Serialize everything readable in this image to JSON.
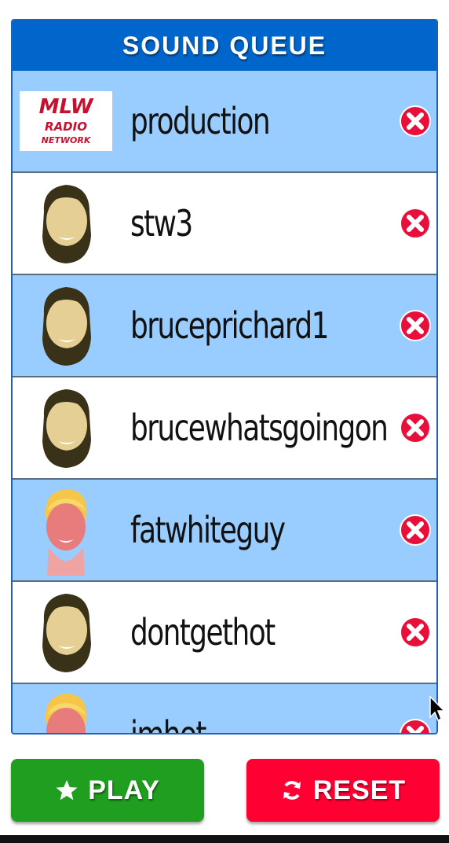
{
  "header": {
    "title": "SOUND QUEUE"
  },
  "queue": {
    "items": [
      {
        "label": "production",
        "avatar": "mlw-radio-network-logo",
        "bg": "blue"
      },
      {
        "label": "stw3",
        "avatar": "bearded-man-face",
        "bg": "white"
      },
      {
        "label": "bruceprichard1",
        "avatar": "bearded-man-face",
        "bg": "blue"
      },
      {
        "label": "brucewhatsgoingon",
        "avatar": "bearded-man-face",
        "bg": "white"
      },
      {
        "label": "fatwhiteguy",
        "avatar": "blonde-man-face",
        "bg": "blue"
      },
      {
        "label": "dontgethot",
        "avatar": "bearded-man-face",
        "bg": "white"
      },
      {
        "label": "imhot",
        "avatar": "blonde-man-face",
        "bg": "blue"
      }
    ],
    "logo_text": {
      "top": "MLW",
      "mid": "RADIO",
      "bottom": "NETWORK"
    }
  },
  "controls": {
    "play_label": "PLAY",
    "reset_label": "RESET"
  },
  "colors": {
    "header": "#0066cc",
    "row_blue": "#99ccff",
    "play": "#1f9e1f",
    "reset": "#ff0033"
  }
}
